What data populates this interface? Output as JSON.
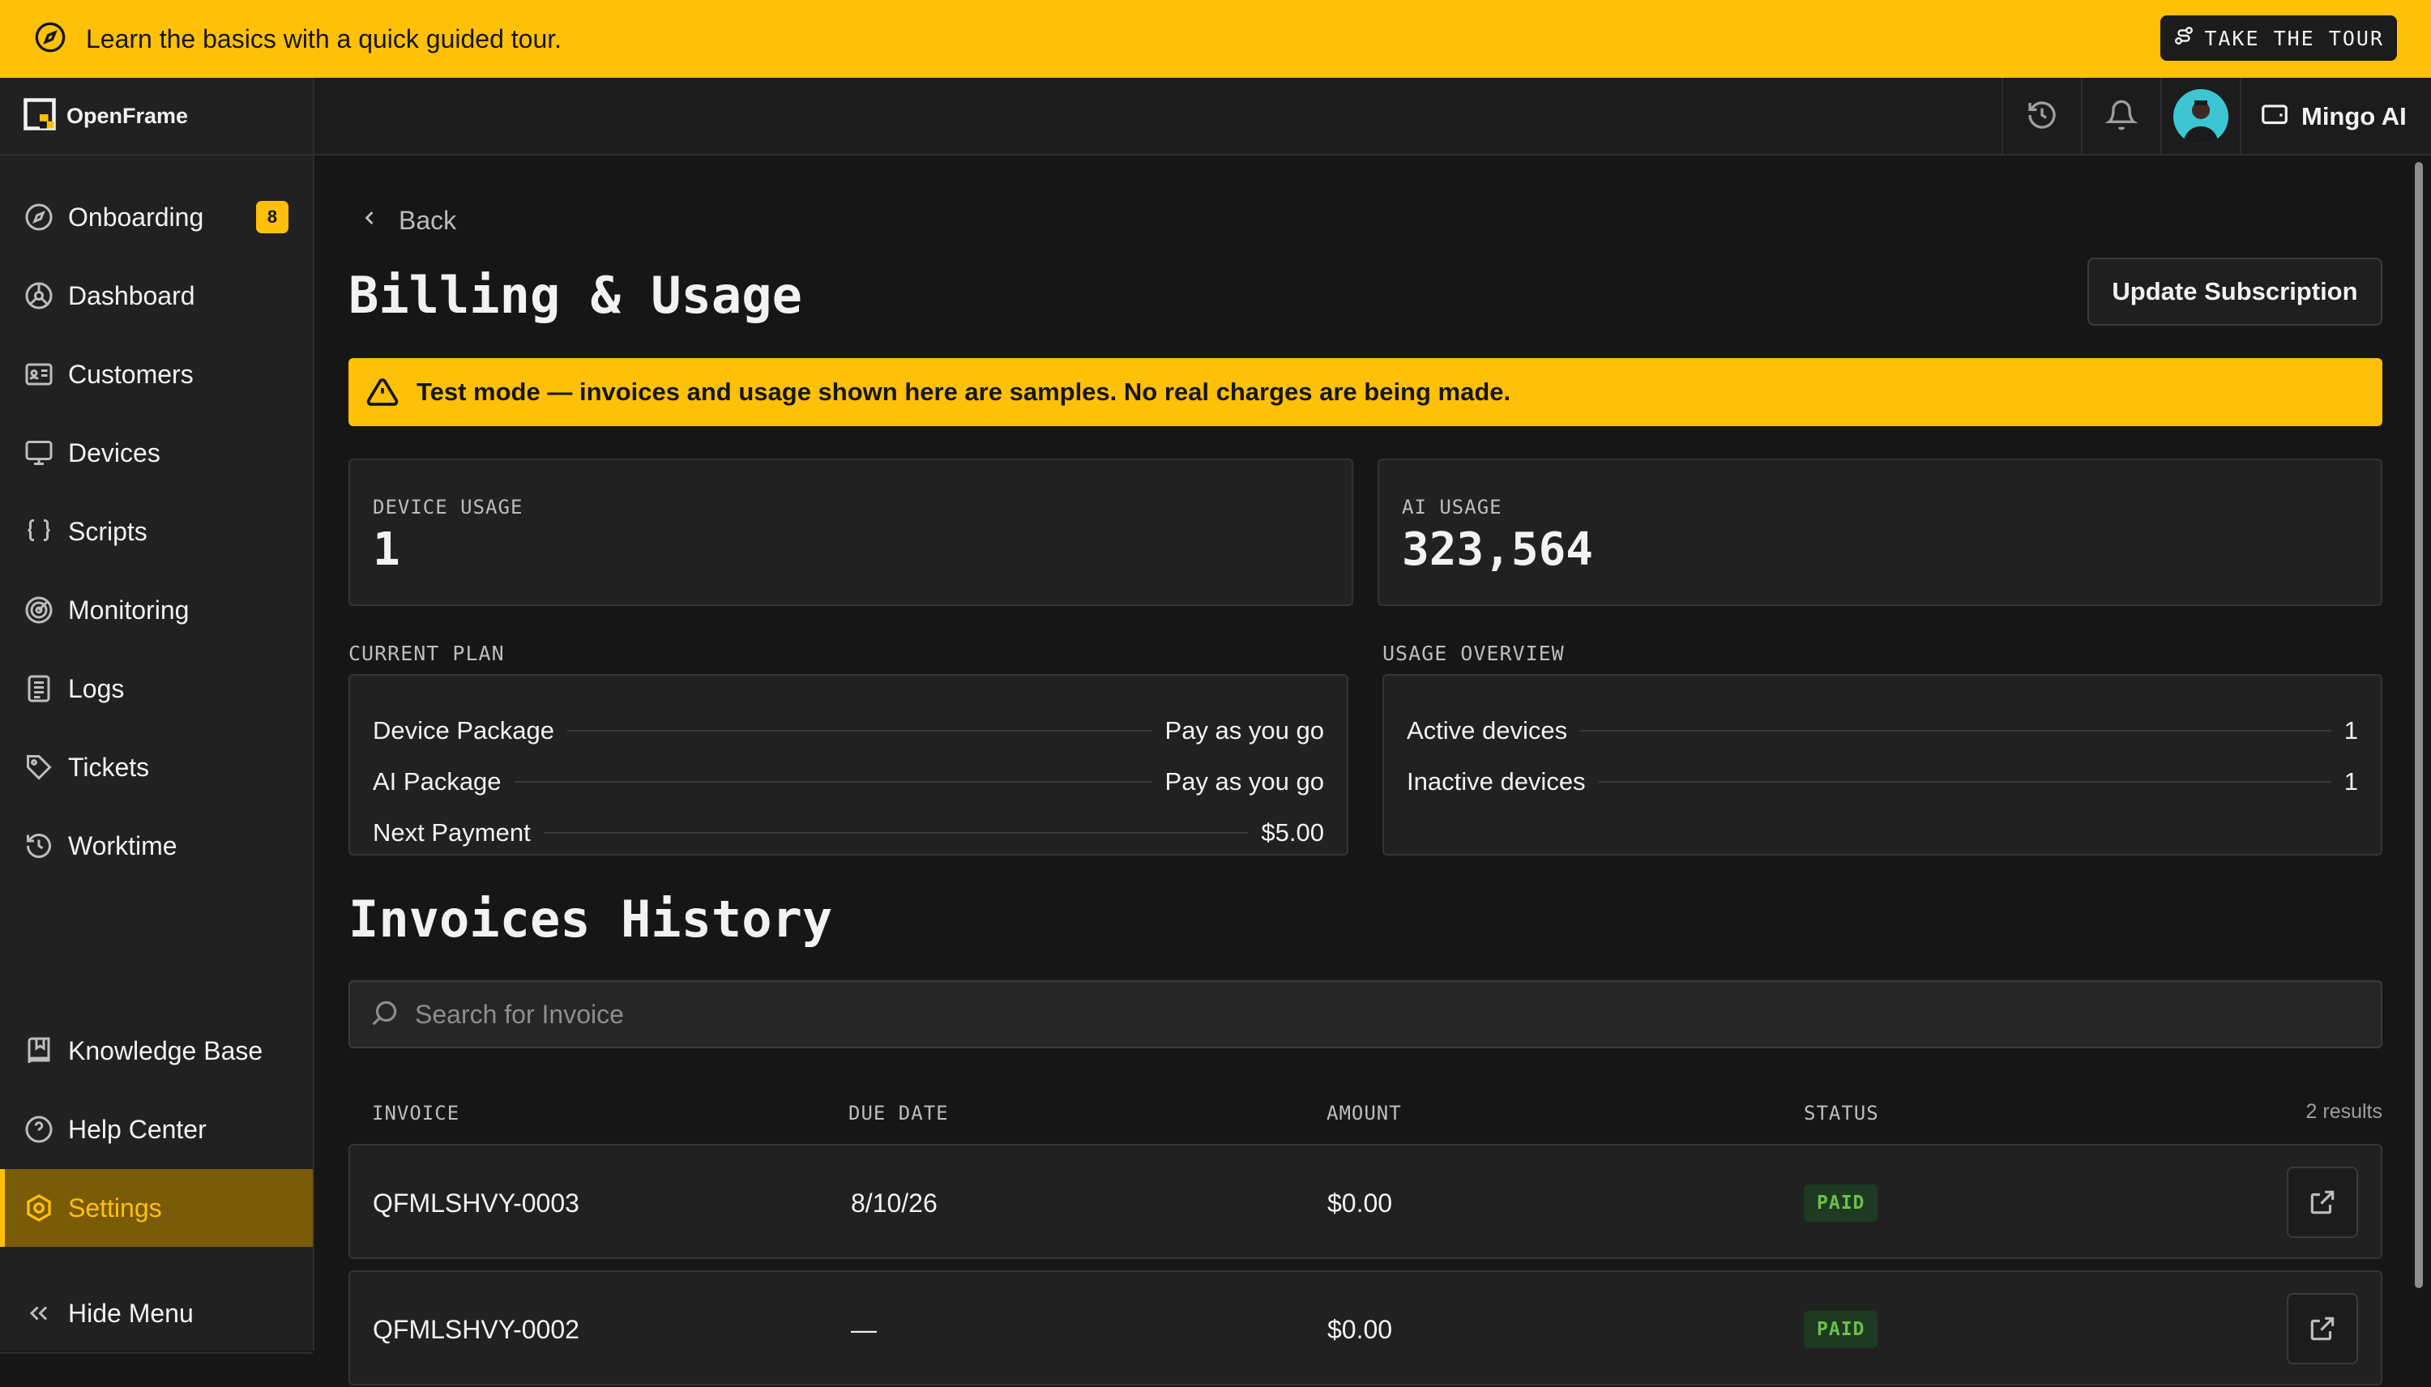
{
  "tour": {
    "text": "Learn the basics with a quick guided tour.",
    "button": "TAKE THE TOUR"
  },
  "brand": "OpenFrame",
  "sidebar": {
    "items": [
      {
        "label": "Onboarding",
        "icon": "compass-icon",
        "badge": "8"
      },
      {
        "label": "Dashboard",
        "icon": "dashboard-icon"
      },
      {
        "label": "Customers",
        "icon": "id-card-icon"
      },
      {
        "label": "Devices",
        "icon": "monitor-icon"
      },
      {
        "label": "Scripts",
        "icon": "braces-icon"
      },
      {
        "label": "Monitoring",
        "icon": "radar-icon"
      },
      {
        "label": "Logs",
        "icon": "list-icon"
      },
      {
        "label": "Tickets",
        "icon": "tag-icon"
      },
      {
        "label": "Worktime",
        "icon": "history-icon"
      }
    ],
    "bottom_items": [
      {
        "label": "Knowledge Base",
        "icon": "book-icon"
      },
      {
        "label": "Help Center",
        "icon": "help-icon"
      },
      {
        "label": "Settings",
        "icon": "settings-icon",
        "active": true
      }
    ],
    "hide_menu": "Hide Menu"
  },
  "header": {
    "ai_label": "Mingo AI"
  },
  "page": {
    "back": "Back",
    "title": "Billing & Usage",
    "update_button": "Update Subscription",
    "test_banner": "Test mode — invoices and usage shown here are samples. No real charges are being made."
  },
  "stats": {
    "device_usage_label": "DEVICE USAGE",
    "device_usage_value": "1",
    "ai_usage_label": "AI USAGE",
    "ai_usage_value": "323,564"
  },
  "current_plan": {
    "label": "CURRENT PLAN",
    "rows": [
      {
        "k": "Device Package",
        "v": "Pay as you go"
      },
      {
        "k": "AI Package",
        "v": "Pay as you go"
      },
      {
        "k": "Next Payment",
        "v": "$5.00"
      }
    ]
  },
  "usage_overview": {
    "label": "USAGE OVERVIEW",
    "rows": [
      {
        "k": "Active devices",
        "v": "1"
      },
      {
        "k": "Inactive devices",
        "v": "1"
      }
    ]
  },
  "invoices": {
    "title": "Invoices History",
    "search_placeholder": "Search for Invoice",
    "columns": [
      "INVOICE",
      "DUE DATE",
      "AMOUNT",
      "STATUS"
    ],
    "results": "2 results",
    "rows": [
      {
        "id": "QFMLSHVY-0003",
        "due": "8/10/26",
        "amount": "$0.00",
        "status": "PAID"
      },
      {
        "id": "QFMLSHVY-0002",
        "due": "—",
        "amount": "$0.00",
        "status": "PAID"
      }
    ]
  },
  "colors": {
    "accent": "#ffc008",
    "paid": "#6bbf4a",
    "bg": "#161616"
  }
}
